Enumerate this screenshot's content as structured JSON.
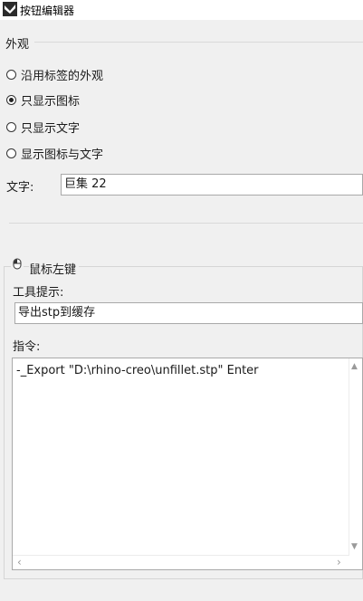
{
  "window": {
    "title": "按钮编辑器"
  },
  "appearance": {
    "group_label": "外观",
    "options": [
      {
        "label": "沿用标签的外观",
        "checked": false
      },
      {
        "label": "只显示图标",
        "checked": true
      },
      {
        "label": "只显示文字",
        "checked": false
      },
      {
        "label": "显示图标与文字",
        "checked": false
      }
    ],
    "text_label": "文字:",
    "text_value": "巨集 22"
  },
  "left_mouse": {
    "group_label": "鼠标左键",
    "tooltip_label": "工具提示:",
    "tooltip_value": "导出stp到缓存",
    "command_label": "指令:",
    "command_value": "-_Export \"D:\\rhino-creo\\unfillet.stp\" Enter"
  },
  "icons": {
    "app": "button-editor-icon",
    "mouse": "mouse-left-button-icon",
    "scroll_up": "chevron-up-icon",
    "scroll_down": "chevron-down-icon",
    "scroll_left": "chevron-left-icon",
    "scroll_right": "chevron-right-icon"
  }
}
